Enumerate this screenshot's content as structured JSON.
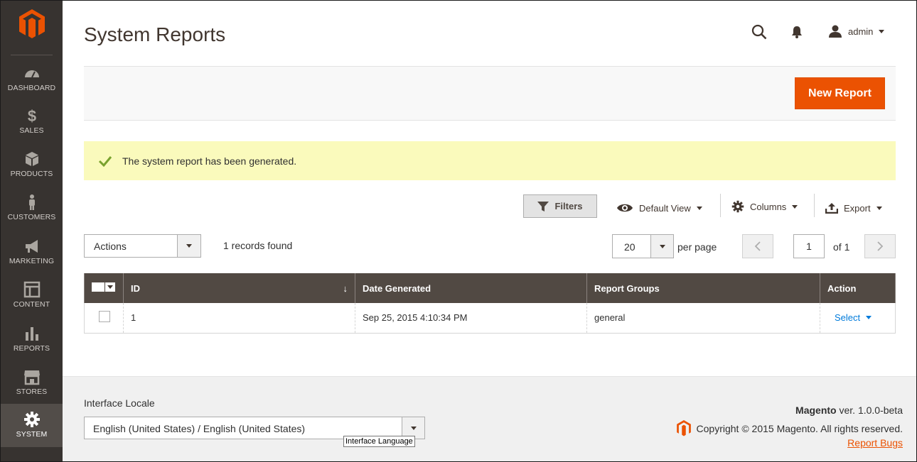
{
  "sidebar": {
    "items": [
      {
        "label": "DASHBOARD",
        "icon": "dashboard-icon"
      },
      {
        "label": "SALES",
        "icon": "dollar-icon"
      },
      {
        "label": "PRODUCTS",
        "icon": "cube-icon"
      },
      {
        "label": "CUSTOMERS",
        "icon": "person-icon"
      },
      {
        "label": "MARKETING",
        "icon": "megaphone-icon"
      },
      {
        "label": "CONTENT",
        "icon": "layout-icon"
      },
      {
        "label": "REPORTS",
        "icon": "bar-chart-icon"
      },
      {
        "label": "STORES",
        "icon": "store-icon"
      },
      {
        "label": "SYSTEM",
        "icon": "gear-icon",
        "active": true
      }
    ]
  },
  "header": {
    "title": "System Reports",
    "user": "admin"
  },
  "actionbar": {
    "new_report": "New Report"
  },
  "message": {
    "text": "The system report has been generated."
  },
  "toolbar": {
    "filters": "Filters",
    "view": "Default View",
    "columns": "Columns",
    "export": "Export",
    "actions": "Actions",
    "records_found": "1 records found",
    "per_page_value": "20",
    "per_page_label": "per page",
    "page_value": "1",
    "page_of": "of 1"
  },
  "grid": {
    "columns": [
      "ID",
      "Date Generated",
      "Report Groups",
      "Action"
    ],
    "sort_indicator": "↓",
    "rows": [
      {
        "id": "1",
        "date": "Sep 25, 2015 4:10:34 PM",
        "groups": "general",
        "action": "Select"
      }
    ]
  },
  "footer": {
    "locale_label": "Interface Locale",
    "locale_value": "English (United States) / English (United States)",
    "tooltip": "Interface Language",
    "brand": "Magento",
    "version": " ver. 1.0.0-beta",
    "copyright": "Copyright © 2015 Magento. All rights reserved.",
    "report_bugs": "Report Bugs"
  },
  "colors": {
    "accent": "#eb5202",
    "sidebar_bg": "#373330",
    "grid_header_bg": "#514943",
    "message_bg": "#fafabc",
    "link": "#007bdb"
  }
}
